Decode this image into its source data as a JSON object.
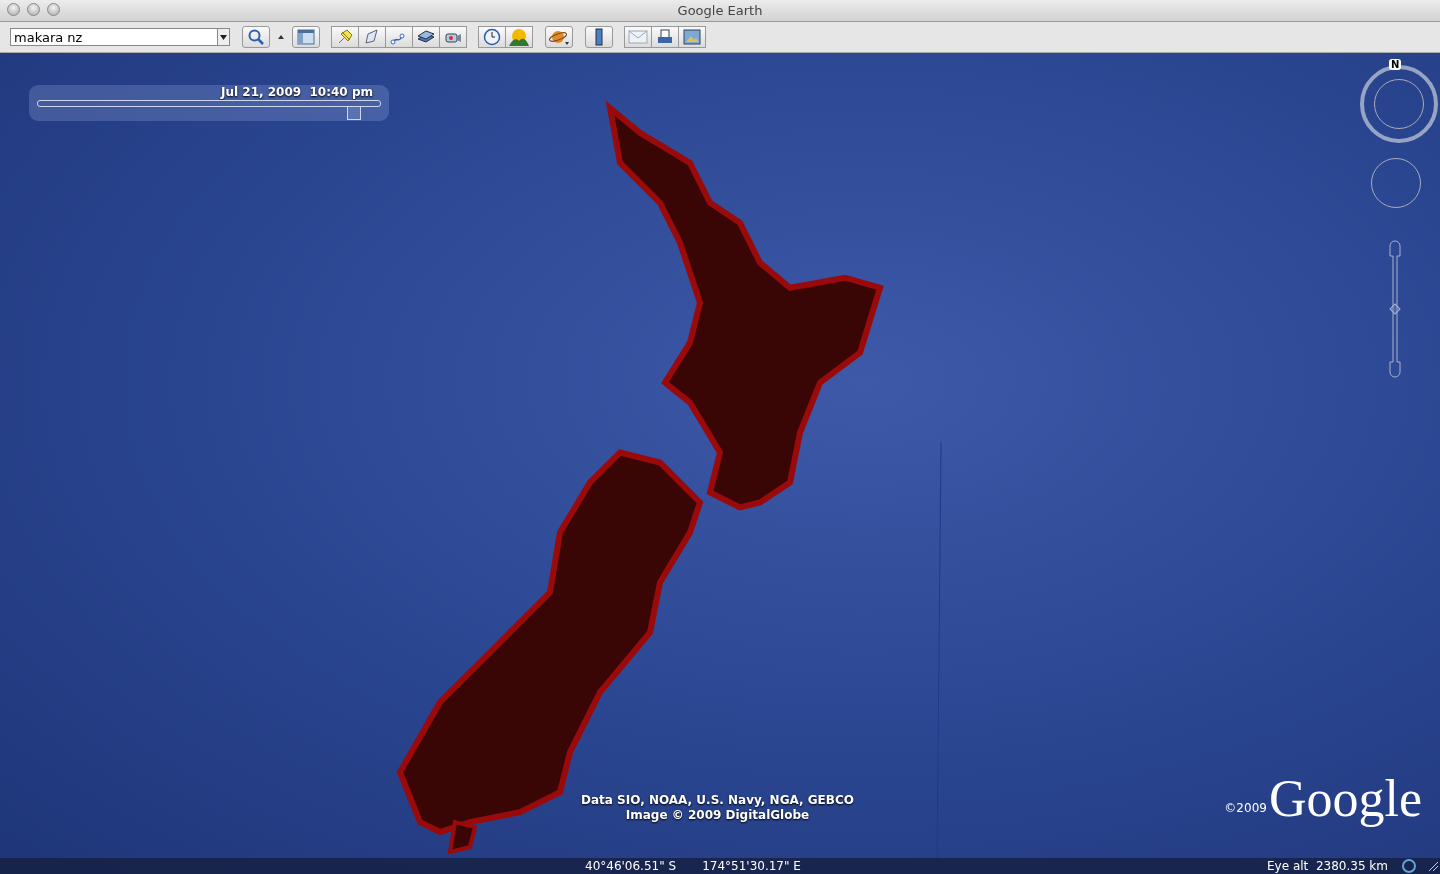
{
  "window": {
    "title": "Google Earth"
  },
  "search": {
    "value": "makara nz"
  },
  "time_slider": {
    "label": "Jul 21, 2009  10:40 pm",
    "level": 0.92
  },
  "compass": {
    "north_label": "N"
  },
  "zoom_slider": {
    "level": 0.5
  },
  "attribution": [
    "Data SIO, NOAA, U.S. Navy, NGA, GEBCO",
    "Image © 2009 DigitalGlobe"
  ],
  "logo": {
    "copyright": "©2009",
    "wordmark": "Google"
  },
  "status_bar": {
    "latitude": "40°46'06.51\" S",
    "longitude": "174°51'30.17\" E",
    "eye_altitude": "Eye alt  2380.35 km"
  }
}
